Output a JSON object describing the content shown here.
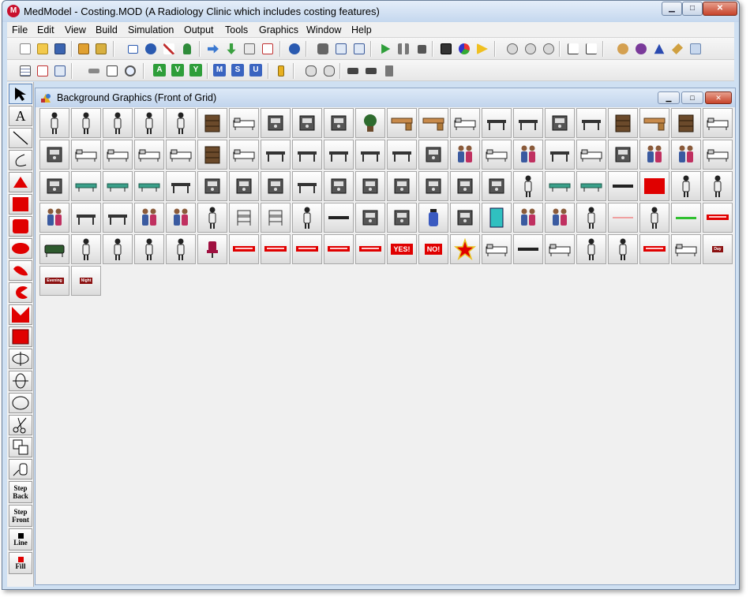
{
  "window": {
    "title": "MedModel - Costing.MOD (A Radiology Clinic which includes costing features)",
    "app_icon_letter": "M",
    "min_glyph": "▁",
    "max_glyph": "□",
    "close_glyph": "✕"
  },
  "menubar": {
    "items": [
      "File",
      "Edit",
      "View",
      "Build",
      "Simulation",
      "Output",
      "Tools",
      "Graphics",
      "Window",
      "Help"
    ]
  },
  "toolbar2_letters": {
    "a": "A",
    "v": "V",
    "y": "Y",
    "m": "M",
    "s": "S",
    "u": "U"
  },
  "palette": {
    "step_back": [
      "Step",
      "Back"
    ],
    "step_front": [
      "Step",
      "Front"
    ],
    "line": "Line",
    "fill": "Fill",
    "text_tool": "A"
  },
  "child": {
    "title": "Background Graphics (Front of Grid)",
    "min_glyph": "▁",
    "max_glyph": "□",
    "close_glyph": "✕"
  },
  "signs": {
    "yes": "YES!",
    "no": "NO!",
    "day": "Day",
    "evening": "Evening",
    "night": "Night"
  },
  "colors": {
    "red": "#e00000",
    "title_bar": "#c4d7ee",
    "close_button": "#c7432a",
    "sign_dark_red": "#8b1010"
  }
}
